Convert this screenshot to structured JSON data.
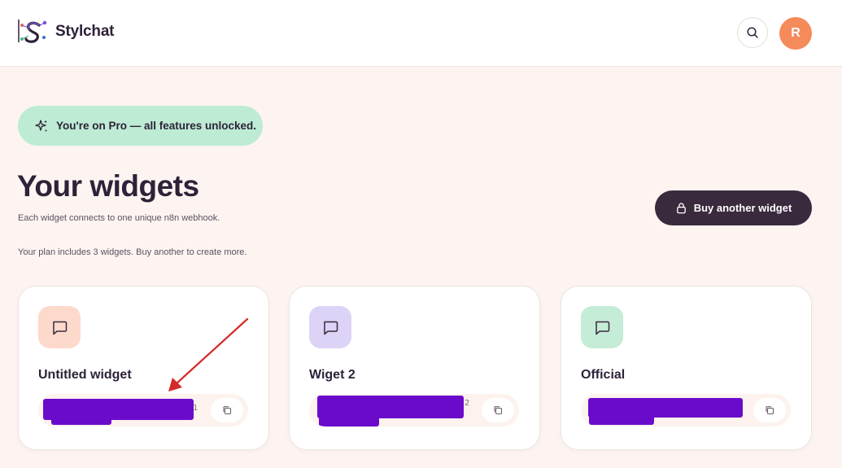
{
  "header": {
    "brand": "Stylchat",
    "avatar_initial": "R",
    "icons": {
      "logo": "stylchat-logo",
      "search": "search-icon"
    }
  },
  "banner": {
    "icon": "sparkle-icon",
    "text": "You're on Pro — all features unlocked."
  },
  "main": {
    "title": "Your widgets",
    "subtitle": "Each widget connects to one unique n8n webhook.",
    "plan_note": "Your plan includes 3 widgets. Buy another to create more.",
    "buy_button": {
      "icon": "lock-icon",
      "label": "Buy another widget"
    }
  },
  "widgets": [
    {
      "name": "Untitled widget",
      "id_suffix": "1",
      "icon": "chat-bubble-icon",
      "tile_color": "#fdd9cc"
    },
    {
      "name": "Wiget 2",
      "id_suffix": "2",
      "icon": "chat-bubble-icon",
      "tile_color": "#ddd3f6"
    },
    {
      "name": "Official",
      "id_suffix": "",
      "icon": "chat-bubble-icon",
      "tile_color": "#c4ecd7"
    }
  ],
  "colors": {
    "accent_dark": "#3a2a3e",
    "avatar": "#f58a5a",
    "pro_banner": "#bdebd4",
    "redaction": "#6a0bcc",
    "annotation_arrow": "#d42a2a"
  }
}
